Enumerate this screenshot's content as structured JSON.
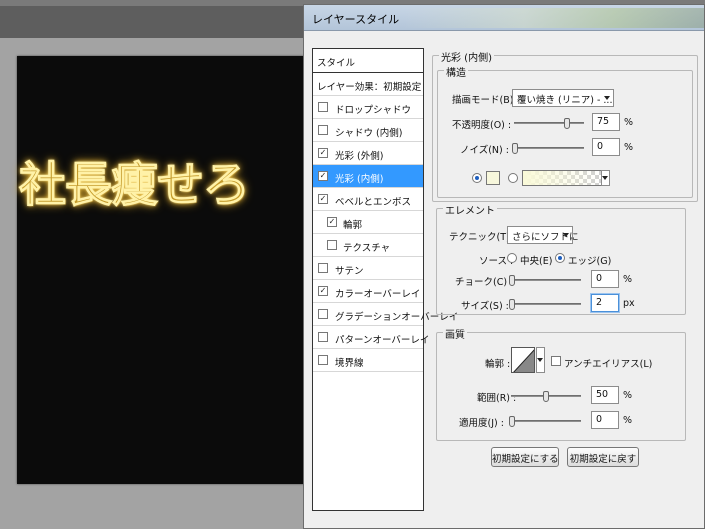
{
  "canvas": {
    "text": "社長痩せろ"
  },
  "dialog": {
    "title": "レイヤースタイル"
  },
  "styles_list": {
    "header": "スタイル",
    "items": [
      {
        "label": "レイヤー効果：初期設定",
        "checkbox": false,
        "checked": false,
        "selected": false
      },
      {
        "label": "ドロップシャドウ",
        "checkbox": true,
        "checked": false,
        "selected": false
      },
      {
        "label": "シャドウ (内側)",
        "checkbox": true,
        "checked": false,
        "selected": false
      },
      {
        "label": "光彩 (外側)",
        "checkbox": true,
        "checked": true,
        "selected": false
      },
      {
        "label": "光彩 (内側)",
        "checkbox": true,
        "checked": true,
        "selected": true
      },
      {
        "label": "ベベルとエンボス",
        "checkbox": true,
        "checked": true,
        "selected": false
      },
      {
        "label": "輪郭",
        "checkbox": true,
        "checked": true,
        "selected": false,
        "indent": true
      },
      {
        "label": "テクスチャ",
        "checkbox": true,
        "checked": false,
        "selected": false,
        "indent": true
      },
      {
        "label": "サテン",
        "checkbox": true,
        "checked": false,
        "selected": false
      },
      {
        "label": "カラーオーバーレイ",
        "checkbox": true,
        "checked": true,
        "selected": false
      },
      {
        "label": "グラデーションオーバーレイ",
        "checkbox": true,
        "checked": false,
        "selected": false
      },
      {
        "label": "パターンオーバーレイ",
        "checkbox": true,
        "checked": false,
        "selected": false
      },
      {
        "label": "境界線",
        "checkbox": true,
        "checked": false,
        "selected": false
      }
    ]
  },
  "inner_glow": {
    "section_title": "光彩 (内側)",
    "structure": {
      "title": "構造",
      "blend_mode_label": "描画モード(B) :",
      "blend_mode_value": "覆い焼き (リニア) - ...",
      "opacity_label": "不透明度(O) :",
      "opacity_value": "75",
      "opacity_unit": "%",
      "noise_label": "ノイズ(N) :",
      "noise_value": "0",
      "noise_unit": "%"
    },
    "elements": {
      "title": "エレメント",
      "technique_label": "テクニック(T) :",
      "technique_value": "さらにソフトに",
      "source_label": "ソース :",
      "source_center": "中央(E)",
      "source_edge": "エッジ(G)",
      "source_selected": "edge",
      "choke_label": "チョーク(C) :",
      "choke_value": "0",
      "choke_unit": "%",
      "size_label": "サイズ(S) :",
      "size_value": "2",
      "size_unit": "px"
    },
    "quality": {
      "title": "画質",
      "contour_label": "輪郭 :",
      "antialias_label": "アンチエイリアス(L)",
      "range_label": "範囲(R) :",
      "range_value": "50",
      "range_unit": "%",
      "jitter_label": "適用度(J) :",
      "jitter_value": "0",
      "jitter_unit": "%"
    },
    "buttons": {
      "make_default": "初期設定にする",
      "reset_default": "初期設定に戻す"
    }
  }
}
